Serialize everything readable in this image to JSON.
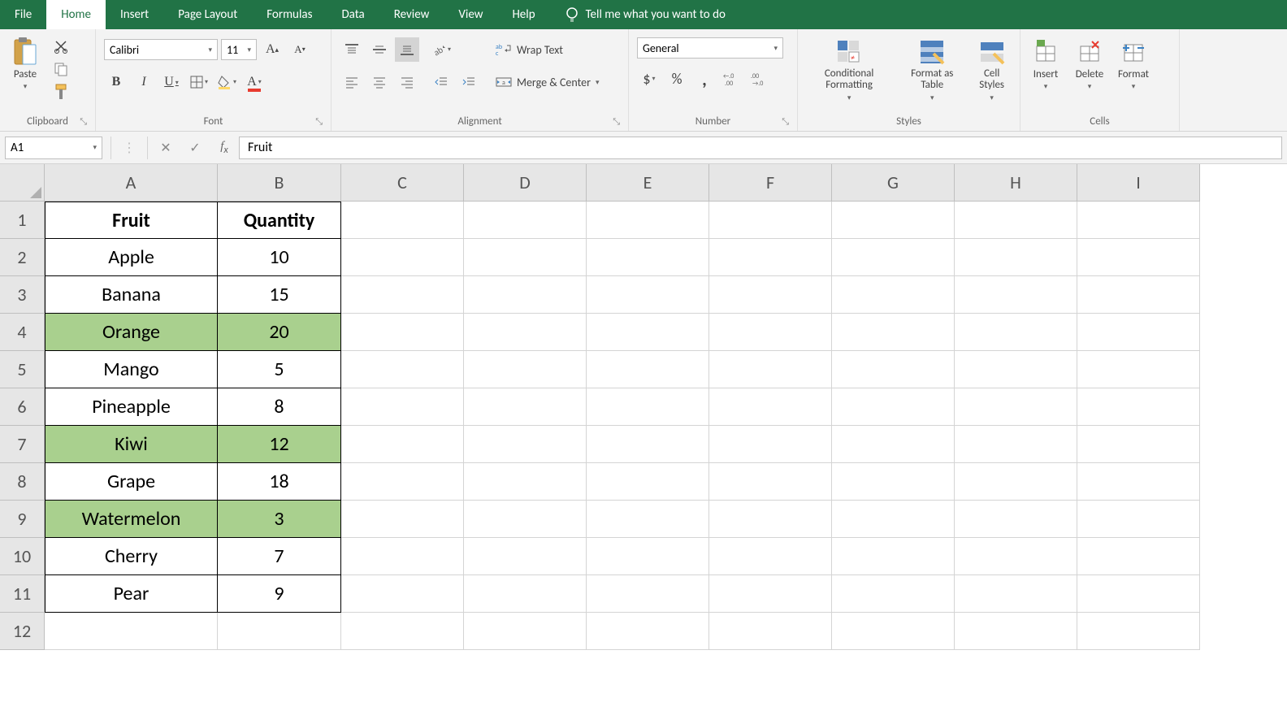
{
  "menu": {
    "tabs": [
      "File",
      "Home",
      "Insert",
      "Page Layout",
      "Formulas",
      "Data",
      "Review",
      "View",
      "Help"
    ],
    "active": "Home",
    "tellme": "Tell me what you want to do"
  },
  "ribbon": {
    "clipboard": {
      "paste": "Paste",
      "label": "Clipboard"
    },
    "font": {
      "name": "Calibri",
      "size": "11",
      "label": "Font"
    },
    "alignment": {
      "wrap": "Wrap Text",
      "merge": "Merge & Center",
      "label": "Alignment"
    },
    "number": {
      "format": "General",
      "label": "Number"
    },
    "styles": {
      "cond": "Conditional Formatting",
      "table": "Format as Table",
      "cell": "Cell Styles",
      "label": "Styles"
    },
    "cells": {
      "insert": "Insert",
      "delete": "Delete",
      "format": "Format",
      "label": "Cells"
    }
  },
  "fbar": {
    "namebox": "A1",
    "formula": "Fruit"
  },
  "grid": {
    "colWidths": {
      "A": 213,
      "B": 152,
      "other": 151
    },
    "columns": [
      "A",
      "B",
      "C",
      "D",
      "E",
      "F",
      "G",
      "H",
      "I"
    ],
    "rowCount": 12,
    "headers": [
      "Fruit",
      "Quantity"
    ],
    "data": [
      {
        "fruit": "Apple",
        "qty": "10",
        "hl": false
      },
      {
        "fruit": "Banana",
        "qty": "15",
        "hl": false
      },
      {
        "fruit": "Orange",
        "qty": "20",
        "hl": true
      },
      {
        "fruit": "Mango",
        "qty": "5",
        "hl": false
      },
      {
        "fruit": "Pineapple",
        "qty": "8",
        "hl": false
      },
      {
        "fruit": "Kiwi",
        "qty": "12",
        "hl": true
      },
      {
        "fruit": "Grape",
        "qty": "18",
        "hl": false
      },
      {
        "fruit": "Watermelon",
        "qty": "3",
        "hl": true
      },
      {
        "fruit": "Cherry",
        "qty": "7",
        "hl": false
      },
      {
        "fruit": "Pear",
        "qty": "9",
        "hl": false
      }
    ]
  }
}
